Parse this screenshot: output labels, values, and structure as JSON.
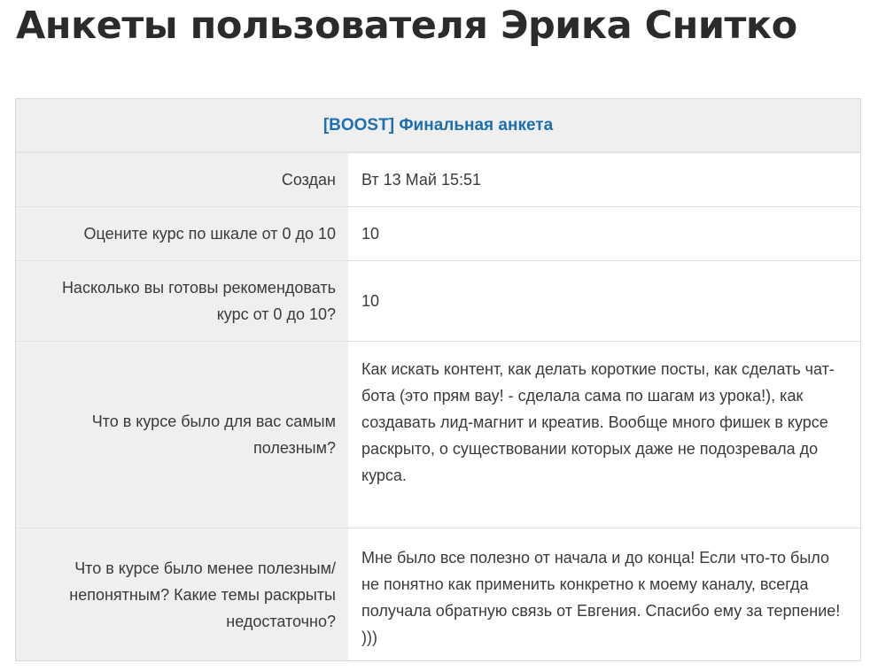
{
  "page": {
    "title": "Анкеты пользователя Эрика Снитко"
  },
  "survey": {
    "link_text": "[BOOST] Финальная анкета",
    "rows": [
      {
        "label": "Создан",
        "value": "Вт 13 Май 15:51"
      },
      {
        "label": "Оцените курс по шкале от 0 до 10",
        "value": "10"
      },
      {
        "label": "Насколько вы готовы рекомендовать курс от 0 до 10?",
        "value": "10"
      },
      {
        "label": "Что в курсе было для вас самым полезным?",
        "value": "Как искать контент, как делать короткие посты, как сделать чат-бота (это прям вау! - сделала сама по шагам из урока!), как создавать лид-магнит и креатив. Вообще много фишек в курсе раскрыто, о существовании которых даже не подозревала до курса."
      },
      {
        "label": "Что в курсе было менее полезным/непонятным? Какие темы раскрыты недостаточно?",
        "value": "Мне было все полезно от начала и до конца! Если что-то было не понятно как применить конкретно к моему каналу, всегда получала обратную связь от Евгения. Спасибо ему за терпение! )))"
      }
    ]
  },
  "colors": {
    "link": "#1d6fb0",
    "label_bg": "#efefef",
    "value_bg": "#ffffff",
    "border": "#d9d9d9",
    "title": "#2b2b2b"
  }
}
